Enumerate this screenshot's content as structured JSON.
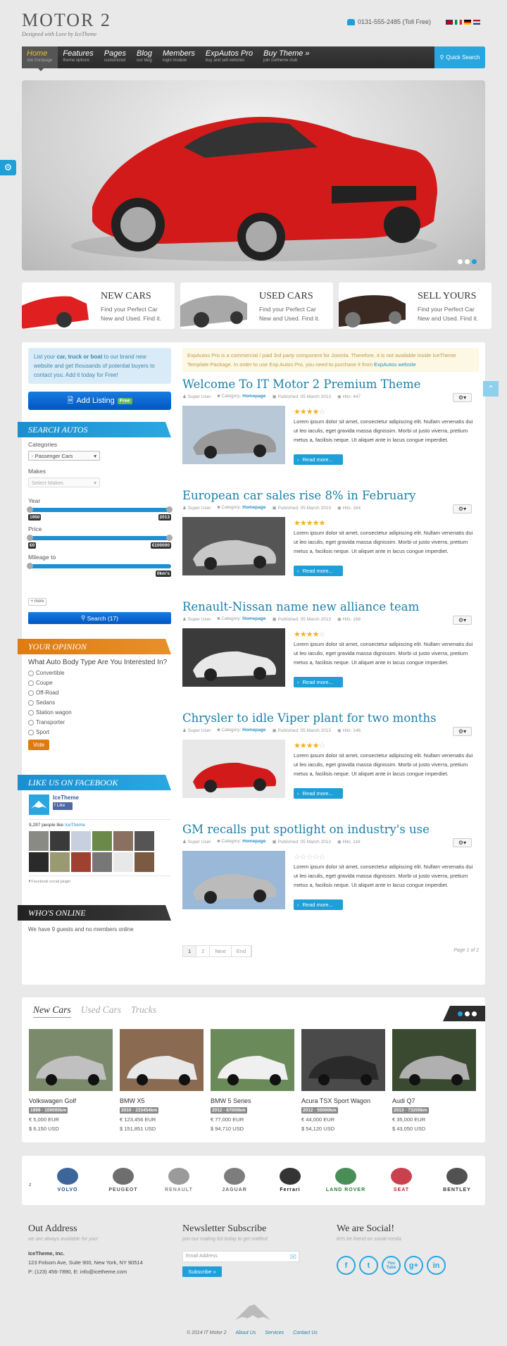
{
  "header": {
    "logo_title": "MOTOR 2",
    "logo_subtitle": "Designed with Love by IceTheme",
    "phone": "0131-555-2485 (Toll Free)",
    "languages": [
      "English",
      "Italian",
      "German",
      "Dutch"
    ]
  },
  "nav": {
    "items": [
      {
        "label": "Home",
        "sub": "site frontpage",
        "active": true
      },
      {
        "label": "Features",
        "sub": "theme options"
      },
      {
        "label": "Pages",
        "sub": "customized"
      },
      {
        "label": "Blog",
        "sub": "our blog"
      },
      {
        "label": "Members",
        "sub": "login module"
      },
      {
        "label": "ExpAutos Pro",
        "sub": "buy and sell vehicles"
      },
      {
        "label": "Buy Theme »",
        "sub": "join icetheme club"
      }
    ],
    "search_label": "Quick Search"
  },
  "slider": {
    "slides": 3,
    "active_slide": 3
  },
  "promos": [
    {
      "title": "NEW CARS",
      "line1": "Find your Perfect Car",
      "line2": "New and Used. Find it."
    },
    {
      "title": "USED CARS",
      "line1": "Find your Perfect Car",
      "line2": "New and Used. Find it."
    },
    {
      "title": "SELL YOURS",
      "line1": "Find your Perfect Car",
      "line2": "New and Used. Find it."
    }
  ],
  "sidebar": {
    "info_pre": "List your ",
    "info_bold": "car, truck or boat",
    "info_post": " to our brand new website and get thousands of potential buyers to contact you. Add it today for Free!",
    "add_listing": "Add Listing",
    "free_badge": "Free",
    "search_title": "SEARCH AUTOS",
    "categories_label": "Categories",
    "categories_value": "- Passenger Cars",
    "makes_label": "Makes",
    "makes_placeholder": "Select Makes",
    "year_label": "Year",
    "year_min": "1950",
    "year_max": "2013",
    "price_label": "Price",
    "price_min": "€0",
    "price_max": "€100000",
    "mileage_label": "Mileage to",
    "mileage_value": "0km's",
    "more_label": "+ more",
    "search_button": "Search (17)",
    "opinion_title": "YOUR OPINION",
    "poll_question": "What Auto Body Type Are You Interested In?",
    "poll_options": [
      "Convertible",
      "Coupe",
      "Off-Road",
      "Sedans",
      "Station wagon",
      "Transporter",
      "Sport"
    ],
    "vote_label": "Vote",
    "facebook_title": "LIKE US ON FACEBOOK",
    "fb_page": "IceTheme",
    "fb_like": "Like",
    "fb_count_pre": "9,297 people like ",
    "fb_count_link": "IceTheme",
    "fb_plugin": "Facebook social plugin",
    "online_title": "WHO'S ONLINE",
    "online_text": "We have 9 guests and no members online"
  },
  "notice": {
    "text": "ExpAutos Pro is a commercial / paid 3rd party component for Joomla. Therefore, it is not available inside IceTheme Template Package. In order to use Exp Autos Pro, you need to purchase it from ",
    "link": "ExpAutos website"
  },
  "articles": [
    {
      "title": "Welcome To IT Motor 2 Premium Theme",
      "author": "Super User",
      "category_label": "Category:",
      "category": "Homepage",
      "published": "Published: 05 March 2013",
      "hits": "Hits: 447",
      "rating": 4,
      "excerpt": "Lorem ipsum dolor sit amet, consectetur adipiscing elit. Nullam venenatis dui ut leo iaculis, eget gravida massa dignissim. Morbi ut justo viverra, pretium metus a, facilisis neque. Ut aliquet ante in lacus congue imperdiet.",
      "read_more": "Read more..."
    },
    {
      "title": "European car sales rise 8% in February",
      "author": "Super User",
      "category_label": "Category:",
      "category": "Homepage",
      "published": "Published: 05 March 2013",
      "hits": "Hits: 164",
      "rating": 5,
      "excerpt": "Lorem ipsum dolor sit amet, consectetur adipiscing elit. Nullam venenatis dui ut leo iaculis, eget gravida massa dignissim. Morbi ut justo viverra, pretium metus a, facilisis neque. Ut aliquet ante in lacus congue imperdiet.",
      "read_more": "Read more..."
    },
    {
      "title": "Renault-Nissan name new alliance team",
      "author": "Super User",
      "category_label": "Category:",
      "category": "Homepage",
      "published": "Published: 05 March 2013",
      "hits": "Hits: 168",
      "rating": 4,
      "excerpt": "Lorem ipsum dolor sit amet, consectetur adipiscing elit. Nullam venenatis dui ut leo iaculis, eget gravida massa dignissim. Morbi ut justo viverra, pretium metus a, facilisis neque. Ut aliquet ante in lacus congue imperdiet.",
      "read_more": "Read more..."
    },
    {
      "title": "Chrysler to idle Viper plant for two months",
      "author": "Super User",
      "category_label": "Category:",
      "category": "Homepage",
      "published": "Published: 05 March 2013",
      "hits": "Hits: 146",
      "rating": 4,
      "excerpt": "Lorem ipsum dolor sit amet, consectetur adipiscing elit. Nullam venenatis dui ut leo iaculis, eget gravida massa dignissim. Morbi ut justo viverra, pretium metus a, facilisis neque. Ut aliquet ante in lacus congue imperdiet.",
      "read_more": "Read more..."
    },
    {
      "title": "GM recalls put spotlight on industry's use",
      "author": "Super User",
      "category_label": "Category:",
      "category": "Homepage",
      "published": "Published: 05 March 2013",
      "hits": "Hits: 116",
      "rating": 0,
      "excerpt": "Lorem ipsum dolor sit amet, consectetur adipiscing elit. Nullam venenatis dui ut leo iaculis, eget gravida massa dignissim. Morbi ut justo viverra, pretium metus a, facilisis neque. Ut aliquet ante in lacus congue imperdiet.",
      "read_more": "Read more..."
    }
  ],
  "pagination": {
    "pages": [
      "1",
      "2",
      "Next",
      "End"
    ],
    "current": "1",
    "page_of": "Page 1 of 2"
  },
  "cars": {
    "tabs": [
      "New Cars",
      "Used Cars",
      "Trucks"
    ],
    "active_tab": "New Cars",
    "items": [
      {
        "name": "Volkswagen Golf",
        "badge": "1999 - 100000km",
        "eur": "€ 5,000 EUR",
        "usd": "$ 6,150 USD"
      },
      {
        "name": "BMW X5",
        "badge": "2010 - 233454km",
        "eur": "€ 123,456 EUR",
        "usd": "$ 151,851 USD"
      },
      {
        "name": "BMW 5 Series",
        "badge": "2012 - 67000km",
        "eur": "€ 77,000 EUR",
        "usd": "$ 94,710 USD"
      },
      {
        "name": "Acura TSX Sport Wagon",
        "badge": "2012 - 55000km",
        "eur": "€ 44,000 EUR",
        "usd": "$ 54,120 USD"
      },
      {
        "name": "Audi Q7",
        "badge": "2013 - 73200km",
        "eur": "€ 35,000 EUR",
        "usd": "$ 43,050 USD"
      }
    ]
  },
  "brands": {
    "prefix": "z",
    "items": [
      "VOLVO",
      "PEUGEOT",
      "RENAULT",
      "JAGUAR",
      "Ferrari",
      "LAND ROVER",
      "SEAT",
      "BENTLEY"
    ]
  },
  "footer": {
    "address_title": "Out Address",
    "address_sub": "we are always available for you!",
    "company": "IceTheme, Inc.",
    "street": "123 Folsom Ave, Suite 900, New York, NY 90514",
    "contact": "P: (123) 456-7890, E: info@icetheme.com",
    "newsletter_title": "Newsletter Subscribe",
    "newsletter_sub": "join our mailing list today to get notified",
    "email_placeholder": "Email Address",
    "subscribe_label": "Subscribe »",
    "social_title": "We are Social!",
    "social_sub": "let's be friend on social media",
    "social": [
      "f",
      "t",
      "You Tube",
      "g+",
      "in"
    ],
    "copyright": "© 2014 IT Motor 2",
    "links": [
      "About Us",
      "Services",
      "Contact Us"
    ]
  },
  "colors": {
    "accent": "#1e9fd8",
    "orange": "#e07b12",
    "title_blue": "#1a7fa8"
  }
}
